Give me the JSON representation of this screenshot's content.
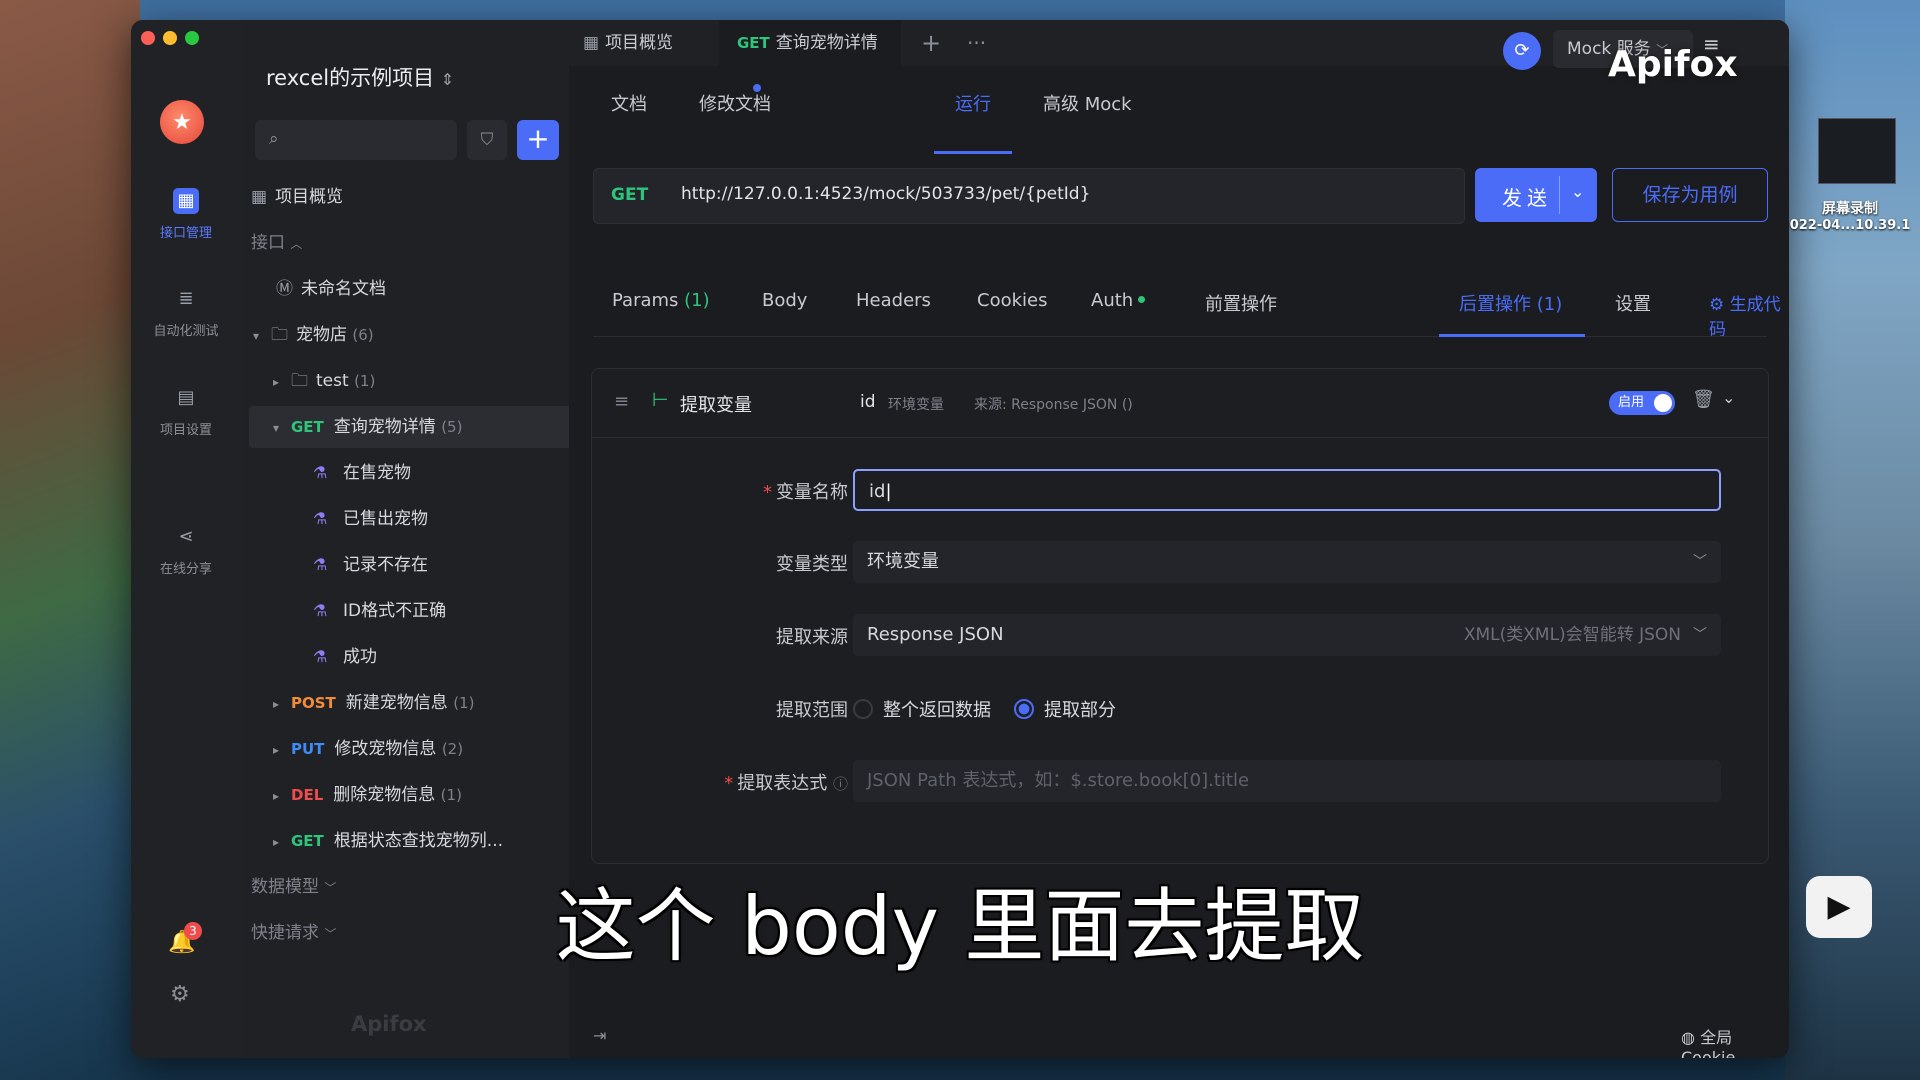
{
  "window": {
    "title": "rexcel的示例项目"
  },
  "rail": {
    "items": [
      {
        "label": "接口管理"
      },
      {
        "label": "自动化测试"
      },
      {
        "label": "项目设置"
      },
      {
        "label": "在线分享"
      }
    ],
    "notification_count": "3"
  },
  "sidebar": {
    "project_title": "rexcel的示例项目",
    "overview": "项目概览",
    "section_api": "接口",
    "unnamed_doc": "未命名文档",
    "folder": {
      "name": "宠物店",
      "count": "(6)"
    },
    "subfolder": {
      "name": "test",
      "count": "(1)"
    },
    "selected": {
      "method": "GET",
      "name": "查询宠物详情",
      "count": "(5)"
    },
    "cases": [
      "在售宠物",
      "已售出宠物",
      "记录不存在",
      "ID格式不正确",
      "成功"
    ],
    "apis": [
      {
        "method": "POST",
        "name": "新建宠物信息",
        "count": "(1)"
      },
      {
        "method": "PUT",
        "name": "修改宠物信息",
        "count": "(2)"
      },
      {
        "method": "DEL",
        "name": "删除宠物信息",
        "count": "(1)"
      },
      {
        "method": "GET",
        "name": "根据状态查找宠物列...",
        "count": ""
      }
    ],
    "data_model": "数据模型",
    "quick_request": "快捷请求",
    "footer_logo": "Apifox"
  },
  "tabs": {
    "overview": "项目概览",
    "active_method": "GET",
    "active_label": "查询宠物详情",
    "mock_service": "Mock 服务"
  },
  "subnav": {
    "doc": "文档",
    "edit": "修改文档",
    "run": "运行",
    "mock": "高级 Mock"
  },
  "request": {
    "method": "GET",
    "url": "http://127.0.0.1:4523/mock/503733/pet/{petId}",
    "send": "发送",
    "save": "保存为用例"
  },
  "param_tabs": {
    "params": "Params",
    "params_count": "(1)",
    "body": "Body",
    "headers": "Headers",
    "cookies": "Cookies",
    "auth": "Auth",
    "pre": "前置操作",
    "post": "后置操作 (1)",
    "settings": "设置",
    "gen_code": "生成代码"
  },
  "extract": {
    "title": "提取变量",
    "var": "id",
    "var_type_tag": "环境变量",
    "source_tag": "来源: Response JSON ()",
    "enabled": "启用",
    "label_name": "变量名称",
    "value_name": "id",
    "label_type": "变量类型",
    "value_type": "环境变量",
    "label_source": "提取来源",
    "value_source": "Response JSON",
    "source_hint": "XML(类XML)会智能转 JSON",
    "label_range": "提取范围",
    "range_all": "整个返回数据",
    "range_part": "提取部分",
    "label_expr": "提取表达式",
    "expr_placeholder": "JSON Path 表达式，如：$.store.book[0].title"
  },
  "footer": {
    "cookie": "全局 Cookie"
  },
  "overlay": {
    "subtitle": "这个 body 里面去提取",
    "watermark": "Apifox",
    "desk_label_1": "屏幕录制",
    "desk_label_2": "022-04...10.39.1"
  },
  "colors": {
    "accent": "#4a6cf7",
    "get": "#2ec57a",
    "post": "#f08c3a",
    "put": "#3d8bf5",
    "del": "#ef4c4c"
  }
}
